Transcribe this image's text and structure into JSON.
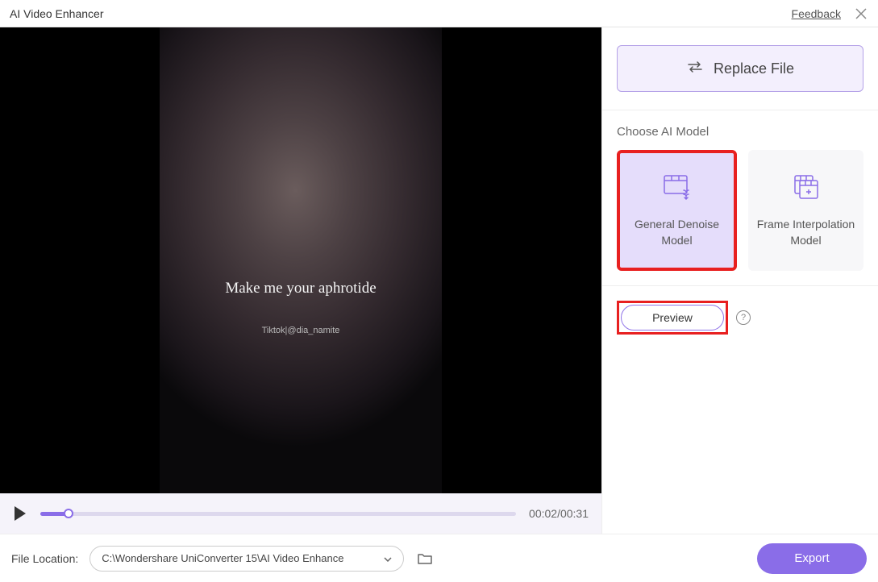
{
  "header": {
    "title": "AI Video Enhancer",
    "feedback": "Feedback"
  },
  "video": {
    "overlay_text_1": "Make me your aphrotide",
    "overlay_text_2": "Tiktok|@dia_namite"
  },
  "player": {
    "time": "00:02/00:31"
  },
  "sidebar": {
    "replace_label": "Replace File",
    "choose_model_label": "Choose AI Model",
    "models": [
      {
        "label": "General Denoise Model"
      },
      {
        "label": "Frame Interpolation Model"
      }
    ],
    "preview_label": "Preview"
  },
  "footer": {
    "file_location_label": "File Location:",
    "file_path": "C:\\Wondershare UniConverter 15\\AI Video Enhance",
    "export_label": "Export"
  }
}
